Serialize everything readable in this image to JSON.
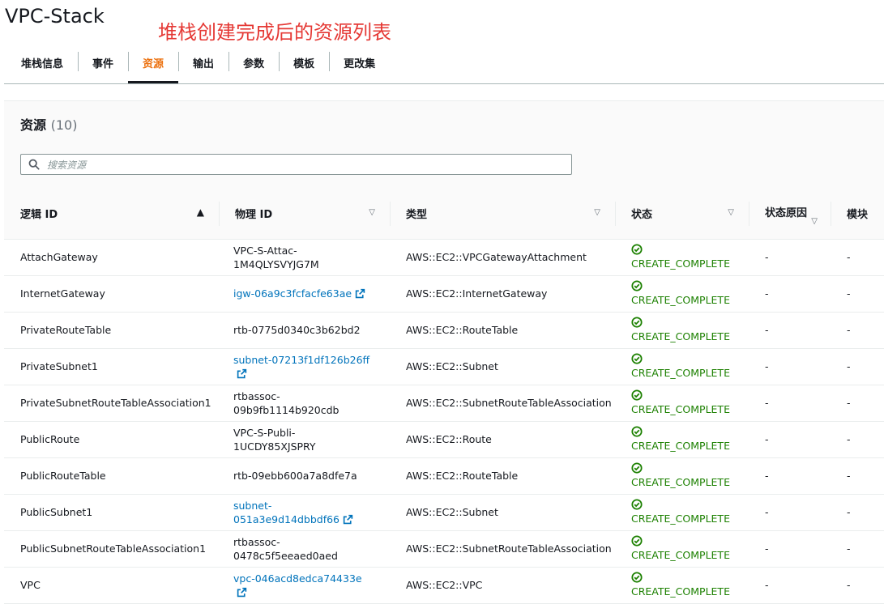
{
  "page": {
    "title": "VPC-Stack",
    "annotation": "堆栈创建完成后的资源列表"
  },
  "tabs": [
    {
      "label": "堆栈信息",
      "active": false
    },
    {
      "label": "事件",
      "active": false
    },
    {
      "label": "资源",
      "active": true
    },
    {
      "label": "输出",
      "active": false
    },
    {
      "label": "参数",
      "active": false
    },
    {
      "label": "模板",
      "active": false
    },
    {
      "label": "更改集",
      "active": false
    }
  ],
  "resources": {
    "header": "资源",
    "count": "(10)",
    "search_placeholder": "搜索资源",
    "columns": {
      "logical_id": "逻辑 ID",
      "physical_id": "物理 ID",
      "type": "类型",
      "status": "状态",
      "status_reason": "状态原因",
      "module": "模块"
    },
    "rows": [
      {
        "logical_id": "AttachGateway",
        "physical_id": "VPC-S-Attac-1M4QLYSVYJG7M",
        "physical_link": false,
        "type": "AWS::EC2::VPCGatewayAttachment",
        "status": "CREATE_COMPLETE",
        "status_reason": "-",
        "module": "-"
      },
      {
        "logical_id": "InternetGateway",
        "physical_id": "igw-06a9c3fcfacfe63ae",
        "physical_link": true,
        "type": "AWS::EC2::InternetGateway",
        "status": "CREATE_COMPLETE",
        "status_reason": "-",
        "module": "-"
      },
      {
        "logical_id": "PrivateRouteTable",
        "physical_id": "rtb-0775d0340c3b62bd2",
        "physical_link": false,
        "type": "AWS::EC2::RouteTable",
        "status": "CREATE_COMPLETE",
        "status_reason": "-",
        "module": "-"
      },
      {
        "logical_id": "PrivateSubnet1",
        "physical_id": "subnet-07213f1df126b26ff",
        "physical_link": true,
        "type": "AWS::EC2::Subnet",
        "status": "CREATE_COMPLETE",
        "status_reason": "-",
        "module": "-"
      },
      {
        "logical_id": "PrivateSubnetRouteTableAssociation1",
        "physical_id": "rtbassoc-09b9fb1114b920cdb",
        "physical_link": false,
        "type": "AWS::EC2::SubnetRouteTableAssociation",
        "status": "CREATE_COMPLETE",
        "status_reason": "-",
        "module": "-"
      },
      {
        "logical_id": "PublicRoute",
        "physical_id": "VPC-S-Publi-1UCDY85XJSPRY",
        "physical_link": false,
        "type": "AWS::EC2::Route",
        "status": "CREATE_COMPLETE",
        "status_reason": "-",
        "module": "-"
      },
      {
        "logical_id": "PublicRouteTable",
        "physical_id": "rtb-09ebb600a7a8dfe7a",
        "physical_link": false,
        "type": "AWS::EC2::RouteTable",
        "status": "CREATE_COMPLETE",
        "status_reason": "-",
        "module": "-"
      },
      {
        "logical_id": "PublicSubnet1",
        "physical_id": "subnet-051a3e9d14dbbdf66",
        "physical_link": true,
        "type": "AWS::EC2::Subnet",
        "status": "CREATE_COMPLETE",
        "status_reason": "-",
        "module": "-"
      },
      {
        "logical_id": "PublicSubnetRouteTableAssociation1",
        "physical_id": "rtbassoc-0478c5f5eeaed0aed",
        "physical_link": false,
        "type": "AWS::EC2::SubnetRouteTableAssociation",
        "status": "CREATE_COMPLETE",
        "status_reason": "-",
        "module": "-"
      },
      {
        "logical_id": "VPC",
        "physical_id": "vpc-046acd8edca74433e",
        "physical_link": true,
        "type": "AWS::EC2::VPC",
        "status": "CREATE_COMPLETE",
        "status_reason": "-",
        "module": "-"
      }
    ]
  },
  "icons": {
    "search": "search-icon",
    "external_link": "external-link-icon",
    "status_success": "check-circle-icon",
    "sort_ascending": "sort-ascending-icon",
    "sort_unsorted": "sort-caret-down-icon"
  },
  "colors": {
    "active_tab": "#ec7211",
    "link": "#0073bb",
    "success": "#1d8102",
    "annotation": "#e53935"
  }
}
